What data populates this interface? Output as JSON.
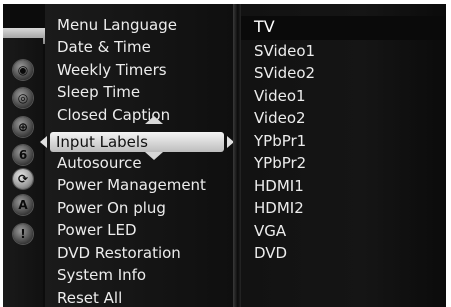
{
  "rail": {
    "icons": [
      {
        "name": "picture-icon",
        "glyph": "◉"
      },
      {
        "name": "audio-icon",
        "glyph": "◎"
      },
      {
        "name": "lock-icon",
        "glyph": "⊕"
      },
      {
        "name": "parental-icon",
        "glyph": "6"
      },
      {
        "name": "setup-icon",
        "glyph": "⟳"
      },
      {
        "name": "advanced-icon",
        "glyph": "A"
      },
      {
        "name": "info-icon",
        "glyph": "!"
      }
    ],
    "active_index": 4
  },
  "menu": {
    "items": [
      "Menu Language",
      "Date & Time",
      "Weekly Timers",
      "Sleep Time",
      "Closed Caption",
      "Input Labels",
      "Autosource",
      "Power Management",
      "Power On plug",
      "Power LED",
      "DVD Restoration",
      "System Info",
      "Reset All"
    ],
    "selected_index": 5
  },
  "submenu": {
    "items": [
      "TV",
      "SVideo1",
      "SVideo2",
      "Video1",
      "Video2",
      "YPbPr1",
      "YPbPr2",
      "HDMI1",
      "HDMI2",
      "VGA",
      "DVD"
    ]
  }
}
